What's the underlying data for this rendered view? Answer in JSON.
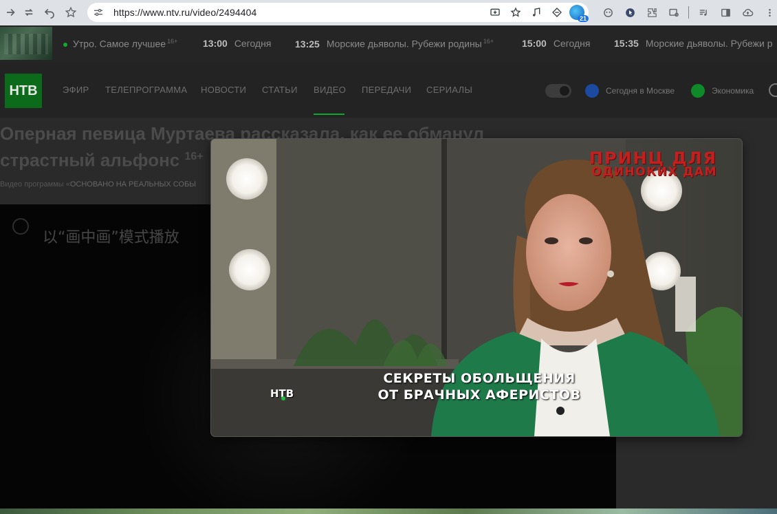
{
  "browser": {
    "url": "https://www.ntv.ru/video/2494404",
    "extension_badge": "21"
  },
  "ticker": {
    "items": [
      {
        "time": "",
        "title": "Утро. Самое лучшее",
        "age": "16+"
      },
      {
        "time": "13:00",
        "title": "Сегодня",
        "age": ""
      },
      {
        "time": "13:25",
        "title": "Морские дьяволы. Рубежи родины",
        "age": "16+"
      },
      {
        "time": "15:00",
        "title": "Сегодня",
        "age": ""
      },
      {
        "time": "15:35",
        "title": "Морские дьяволы. Рубежи р",
        "age": ""
      }
    ]
  },
  "nav": {
    "logo": "НТВ",
    "items": [
      "ЭФИР",
      "ТЕЛЕПРОГРАММА",
      "НОВОСТИ",
      "СТАТЬИ",
      "ВИДЕО",
      "ПЕРЕДАЧИ",
      "СЕРИАЛЫ"
    ],
    "active": "ВИДЕО",
    "chips": [
      "Сегодня в Москве",
      "Экономика"
    ],
    "colors": {
      "chip1": "#1c4aa0",
      "chip2": "#0f8a28",
      "accent": "#10a431"
    }
  },
  "article": {
    "title_line1": "Оперная певица Муртаева рассказала, как ее обманул",
    "title_line2": "страстный альфонс",
    "age": "16+",
    "meta_prefix": "Видео программы «",
    "meta_program": "ОСНОВАНО НА РЕАЛЬНЫХ СОБЫ"
  },
  "player": {
    "pip_notice": "以“画中画”模式播放"
  },
  "pip_video": {
    "show_title_line1": "ПРИНЦ ДЛЯ",
    "show_title_line2": "ОДИНОКИХ ДАМ",
    "subtitle_line1": "СЕКРЕТЫ ОБОЛЬЩЕНИЯ",
    "subtitle_line2": "ОТ БРАЧНЫХ АФЕРИСТОВ",
    "channel_mark": "НТВ"
  }
}
